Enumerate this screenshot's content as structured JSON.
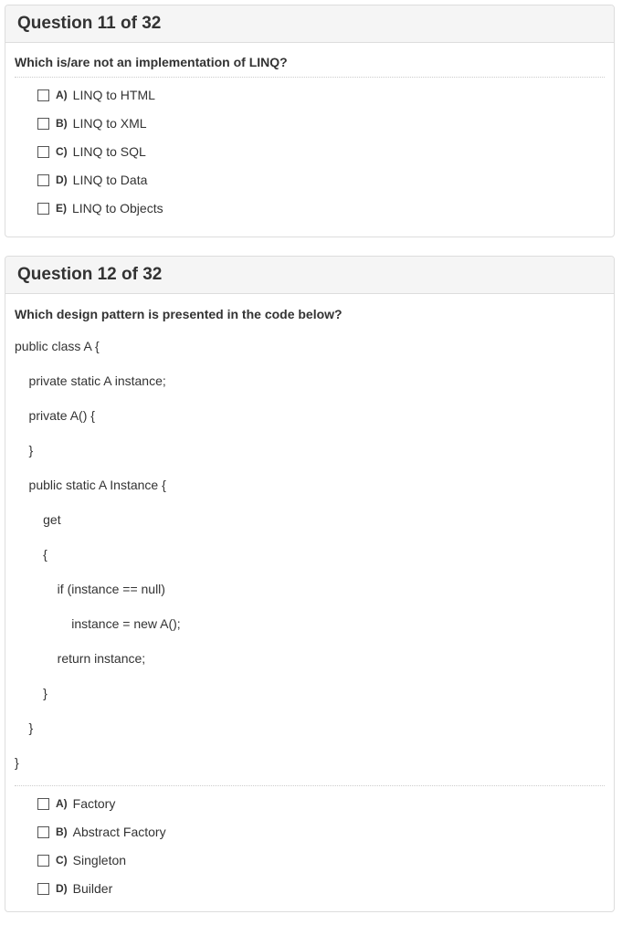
{
  "questions": [
    {
      "title": "Question 11 of 32",
      "text": "Which is/are not an implementation of LINQ?",
      "code": [],
      "options": [
        {
          "letter": "A)",
          "text": "LINQ to HTML"
        },
        {
          "letter": "B)",
          "text": "LINQ to XML"
        },
        {
          "letter": "C)",
          "text": "LINQ to SQL"
        },
        {
          "letter": "D)",
          "text": "LINQ to Data"
        },
        {
          "letter": "E)",
          "text": "LINQ to Objects"
        }
      ]
    },
    {
      "title": "Question 12 of 32",
      "text": "Which design pattern is presented in the code below?",
      "code": [
        "public class A {",
        "    private static A instance;",
        "    private A() {",
        "    }",
        "    public static A Instance {",
        "        get",
        "        {",
        "            if (instance == null)",
        "                instance = new A();",
        "            return instance;",
        "        }",
        "    }",
        "}"
      ],
      "options": [
        {
          "letter": "A)",
          "text": "Factory"
        },
        {
          "letter": "B)",
          "text": "Abstract Factory"
        },
        {
          "letter": "C)",
          "text": "Singleton"
        },
        {
          "letter": "D)",
          "text": "Builder"
        }
      ]
    }
  ]
}
